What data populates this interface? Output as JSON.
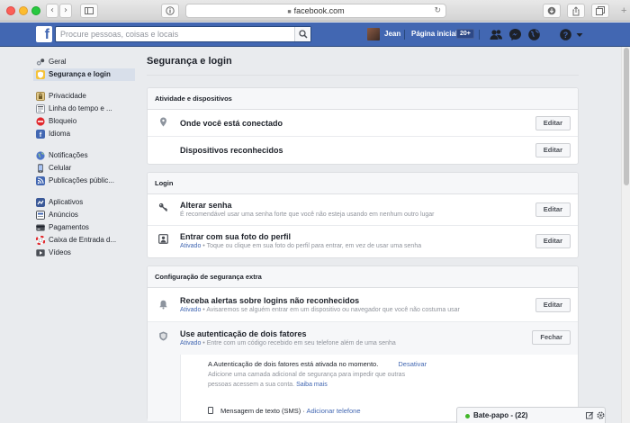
{
  "browser": {
    "url": "facebook.com",
    "colors": {
      "close": "#fc5f57",
      "minimize": "#fdbc2e",
      "zoom": "#28c840"
    }
  },
  "topbar": {
    "logo": "f",
    "search_placeholder": "Procure pessoas, coisas e locais",
    "user_name": "Jean",
    "home_label": "Página inicial",
    "home_badge": "20+",
    "brand_color": "#4267b2"
  },
  "sidebar": {
    "groups": [
      [
        {
          "label": "Geral",
          "icon": "gears-icon",
          "active": false
        },
        {
          "label": "Segurança e login",
          "icon": "shield-icon",
          "active": true
        }
      ],
      [
        {
          "label": "Privacidade",
          "icon": "privacy-icon",
          "active": false
        },
        {
          "label": "Linha do tempo e ...",
          "icon": "timeline-icon",
          "active": false
        },
        {
          "label": "Bloqueio",
          "icon": "block-icon",
          "active": false
        },
        {
          "label": "Idioma",
          "icon": "language-icon",
          "active": false
        }
      ],
      [
        {
          "label": "Notificações",
          "icon": "globe-icon",
          "active": false
        },
        {
          "label": "Celular",
          "icon": "mobile-icon",
          "active": false
        },
        {
          "label": "Publicações públic...",
          "icon": "rss-icon",
          "active": false
        }
      ],
      [
        {
          "label": "Aplicativos",
          "icon": "apps-icon",
          "active": false
        },
        {
          "label": "Anúncios",
          "icon": "ads-icon",
          "active": false
        },
        {
          "label": "Pagamentos",
          "icon": "payments-icon",
          "active": false
        },
        {
          "label": "Caixa de Entrada d...",
          "icon": "lifebuoy-icon",
          "active": false
        },
        {
          "label": "Vídeos",
          "icon": "video-icon",
          "active": false
        }
      ]
    ]
  },
  "main": {
    "title": "Segurança e login",
    "sections": {
      "activity": {
        "header": "Atividade e dispositivos",
        "rows": [
          {
            "title": "Onde você está conectado",
            "button": "Editar",
            "icon": "location-pin-icon"
          },
          {
            "title": "Dispositivos reconhecidos",
            "button": "Editar"
          }
        ]
      },
      "login": {
        "header": "Login",
        "rows": [
          {
            "title": "Alterar senha",
            "subtitle": "É recomendável usar uma senha forte que você não esteja usando em nenhum outro lugar",
            "button": "Editar",
            "icon": "key-icon"
          },
          {
            "title": "Entrar com sua foto do perfil",
            "status": "Ativado",
            "subtitle": " • Toque ou clique em sua foto do perfil para entrar, em vez de usar uma senha",
            "button": "Editar",
            "icon": "profile-photo-icon"
          }
        ]
      },
      "extra": {
        "header": "Configuração de segurança extra",
        "rows": [
          {
            "title": "Receba alertas sobre logins não reconhecidos",
            "status": "Ativado",
            "subtitle": " • Avisaremos se alguém entrar em um dispositivo ou navegador que você não costuma usar",
            "button": "Editar",
            "icon": "bell-icon"
          },
          {
            "title": "Use autenticação de dois fatores",
            "status": "Ativado",
            "subtitle": " • Entre com um código recebido em seu telefone além de uma senha",
            "button": "Fechar",
            "icon": "shield-icon"
          }
        ],
        "twofa": {
          "status_text": "A Autenticação de dois fatores está ativada no momento.",
          "deactivate": "Desativar",
          "desc1": "Adicione uma camada adicional de segurança para impedir que outras",
          "desc2": "pessoas acessem a sua conta. ",
          "learn_more": "Saiba mais",
          "sms_label": "Mensagem de texto (SMS)",
          "sms_sep": " · ",
          "add_phone": "Adicionar telefone"
        }
      }
    }
  },
  "chat": {
    "label": "Bate-papo - (22)"
  }
}
